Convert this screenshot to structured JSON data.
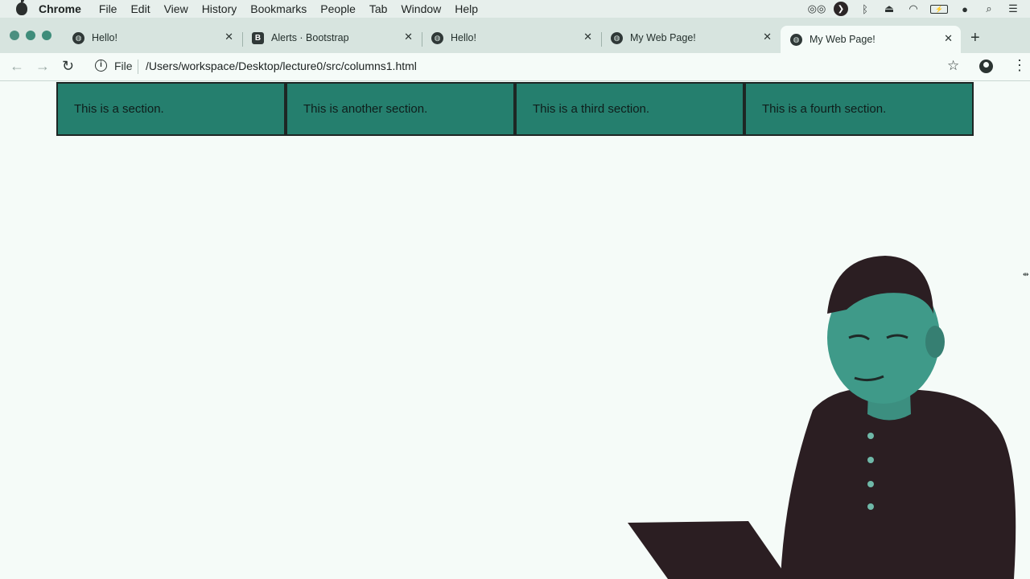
{
  "menubar": {
    "items": [
      "Chrome",
      "File",
      "Edit",
      "View",
      "History",
      "Bookmarks",
      "People",
      "Tab",
      "Window",
      "Help"
    ],
    "status_icons": [
      "glasses-icon",
      "play-icon",
      "bluetooth-icon",
      "eject-icon",
      "wifi-icon",
      "battery-icon",
      "user-icon",
      "search-icon",
      "list-icon"
    ]
  },
  "tabs": [
    {
      "title": "Hello!",
      "favicon": "globe-icon",
      "active": false
    },
    {
      "title": "Alerts · Bootstrap",
      "favicon": "bootstrap-icon",
      "active": false
    },
    {
      "title": "Hello!",
      "favicon": "globe-icon",
      "active": false
    },
    {
      "title": "My Web Page!",
      "favicon": "globe-icon",
      "active": false
    },
    {
      "title": "My Web Page!",
      "favicon": "globe-icon",
      "active": true
    }
  ],
  "toolbar": {
    "scheme_label": "File",
    "url": "/Users/workspace/Desktop/lecture0/src/columns1.html"
  },
  "page": {
    "sections": [
      "This is a section.",
      "This is another section.",
      "This is a third section.",
      "This is a fourth section."
    ]
  },
  "colors": {
    "section_bg": "#257f6e",
    "page_bg": "#f5fbf8",
    "accent": "#3f8d7b"
  }
}
